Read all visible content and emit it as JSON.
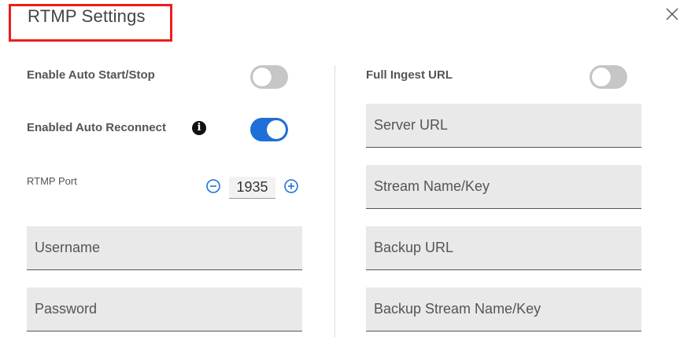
{
  "dialog": {
    "title": "RTMP Settings",
    "close_icon": "close-icon",
    "highlight_color": "#ee1c1c"
  },
  "left": {
    "auto_start_stop": {
      "label": "Enable Auto Start/Stop",
      "enabled": false
    },
    "auto_reconnect": {
      "label": "Enabled Auto Reconnect",
      "info_icon": "info-icon",
      "info_glyph": "i",
      "enabled": true
    },
    "rtmp_port": {
      "label": "RTMP Port",
      "value": "1935",
      "decrement_icon": "minus-circle-icon",
      "increment_icon": "plus-circle-icon"
    },
    "username": {
      "placeholder": "Username",
      "value": ""
    },
    "password": {
      "placeholder": "Password",
      "value": ""
    }
  },
  "right": {
    "full_ingest_url": {
      "label": "Full Ingest URL",
      "enabled": false
    },
    "server_url": {
      "placeholder": "Server URL",
      "value": ""
    },
    "stream_name_key": {
      "placeholder": "Stream Name/Key",
      "value": ""
    },
    "backup_url": {
      "placeholder": "Backup URL",
      "value": ""
    },
    "backup_stream_name_key": {
      "placeholder": "Backup Stream Name/Key",
      "value": ""
    }
  },
  "colors": {
    "toggle_on": "#1e6fd8",
    "toggle_off": "#c6c6c6",
    "field_bg": "#e9e9e9",
    "stepper_icon": "#1e6fd8"
  }
}
